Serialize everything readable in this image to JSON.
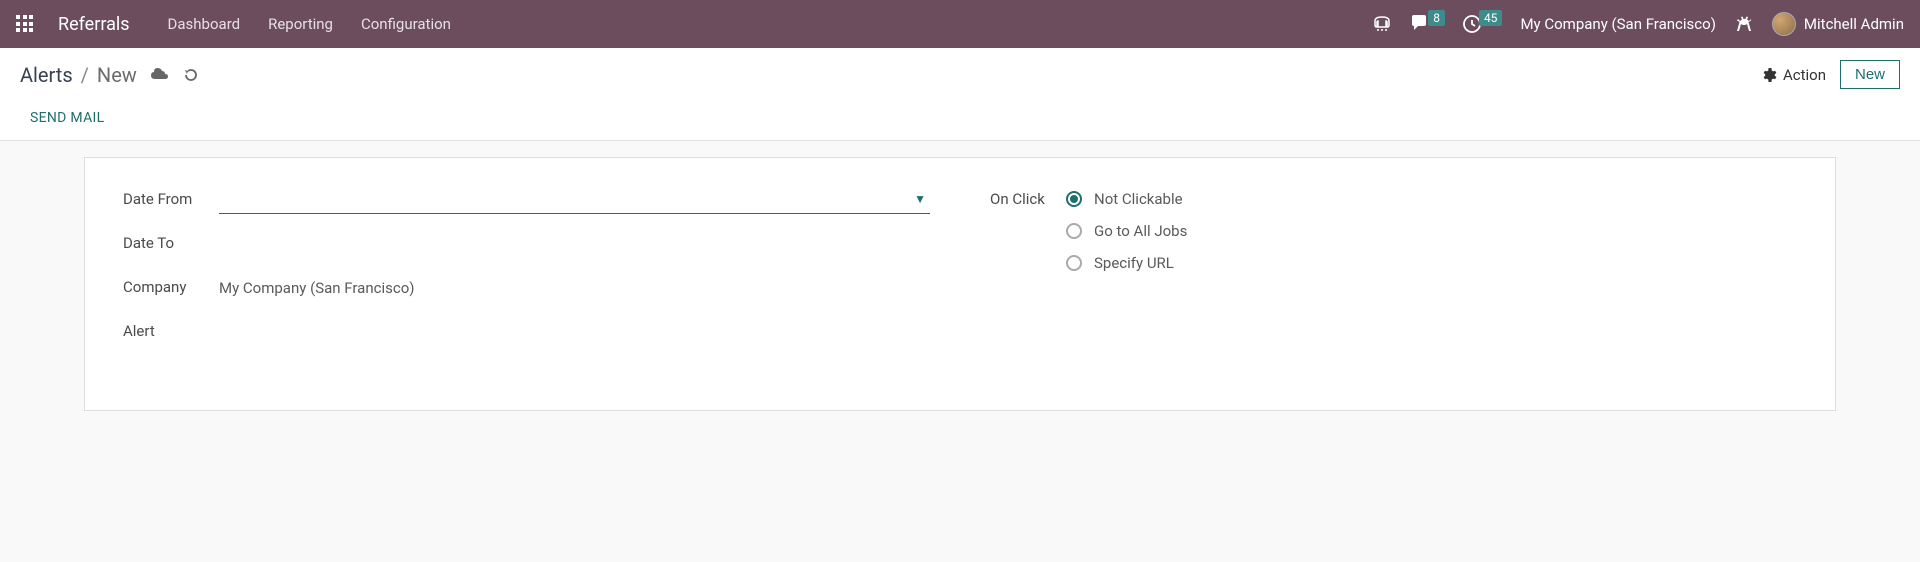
{
  "header": {
    "brand": "Referrals",
    "nav": {
      "dashboard": "Dashboard",
      "reporting": "Reporting",
      "configuration": "Configuration"
    },
    "badges": {
      "messages": "8",
      "activities": "45"
    },
    "company": "My Company (San Francisco)",
    "user": "Mitchell Admin"
  },
  "breadcrumb": {
    "root": "Alerts",
    "sep": "/",
    "current": "New"
  },
  "actions": {
    "action_label": "Action",
    "new_label": "New"
  },
  "buttons": {
    "send_mail": "SEND MAIL"
  },
  "form": {
    "left": {
      "date_from_label": "Date From",
      "date_from_value": "",
      "date_to_label": "Date To",
      "date_to_value": "",
      "company_label": "Company",
      "company_value": "My Company (San Francisco)",
      "alert_label": "Alert",
      "alert_value": ""
    },
    "right": {
      "on_click_label": "On Click",
      "options": {
        "not_clickable": "Not Clickable",
        "all_jobs": "Go to All Jobs",
        "specify_url": "Specify URL"
      }
    }
  }
}
